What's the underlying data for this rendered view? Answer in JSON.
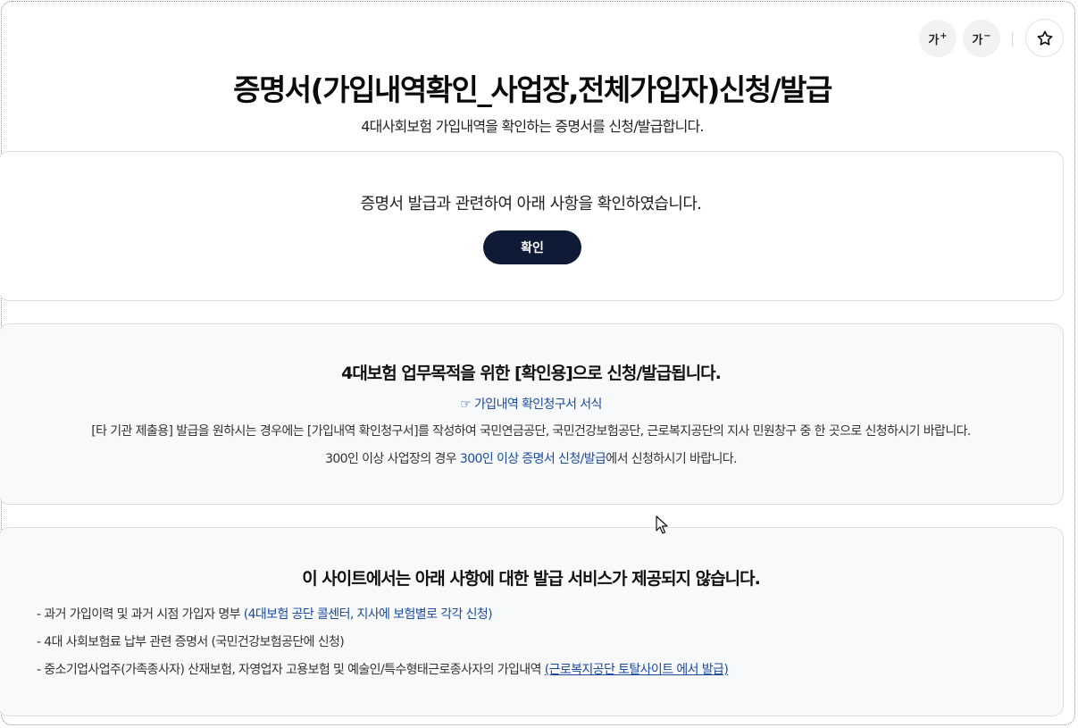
{
  "toolbar": {
    "font_increase_label": "가",
    "font_increase_mark": "+",
    "font_decrease_label": "가",
    "font_decrease_mark": "−",
    "favorite_icon": "star-icon"
  },
  "page": {
    "title": "증명서(가입내역확인_사업장,전체가입자)신청/발급",
    "subtitle": "4대사회보험 가입내역을 확인하는 증명서를 신청/발급합니다."
  },
  "confirm_card": {
    "text": "증명서 발급과 관련하여 아래 사항을 확인하였습니다.",
    "button_label": "확인"
  },
  "purpose_card": {
    "heading": "4대보험 업무목적을 위한 [확인용]으로 신청/발급됩니다.",
    "form_link_icon": "☞",
    "form_link": "가입내역 확인청구서 서식",
    "notice": "[타 기관 제출용] 발급을 원하시는 경우에는 [가입내역 확인청구서]를 작성하여 국민연금공단, 국민건강보험공단, 근로복지공단의 지사 민원창구 중 한 곳으로 신청하시기 바랍니다.",
    "large_prefix": "300인 이상 사업장의 경우 ",
    "large_link": "300인 이상 증명서 신청/발급",
    "large_suffix": "에서 신청하시기 바랍니다."
  },
  "not_provided_card": {
    "heading": "이 사이트에서는 아래 사항에 대한 발급 서비스가 제공되지 않습니다.",
    "items": [
      {
        "text": "- 과거 가입이력 및 과거 시점 가입자 명부 ",
        "note": "(4대보험 공단 콜센터, 지사에 보험별로 각각 신청)"
      },
      {
        "text": "- 4대 사회보험료 납부 관련 증명서 (국민건강보험공단에 신청)",
        "note": ""
      },
      {
        "text": "- 중소기업사업주(가족종사자) 산재보험, 자영업자 고용보험 및 예술인/특수형태근로종사자의 가입내역  ",
        "note": "(근로복지공단 토탈사이트 에서 발급)"
      }
    ]
  },
  "colors": {
    "button_bg": "#0e1a36",
    "link": "#1b4aa0",
    "card_bg": "#f8f9fa"
  }
}
